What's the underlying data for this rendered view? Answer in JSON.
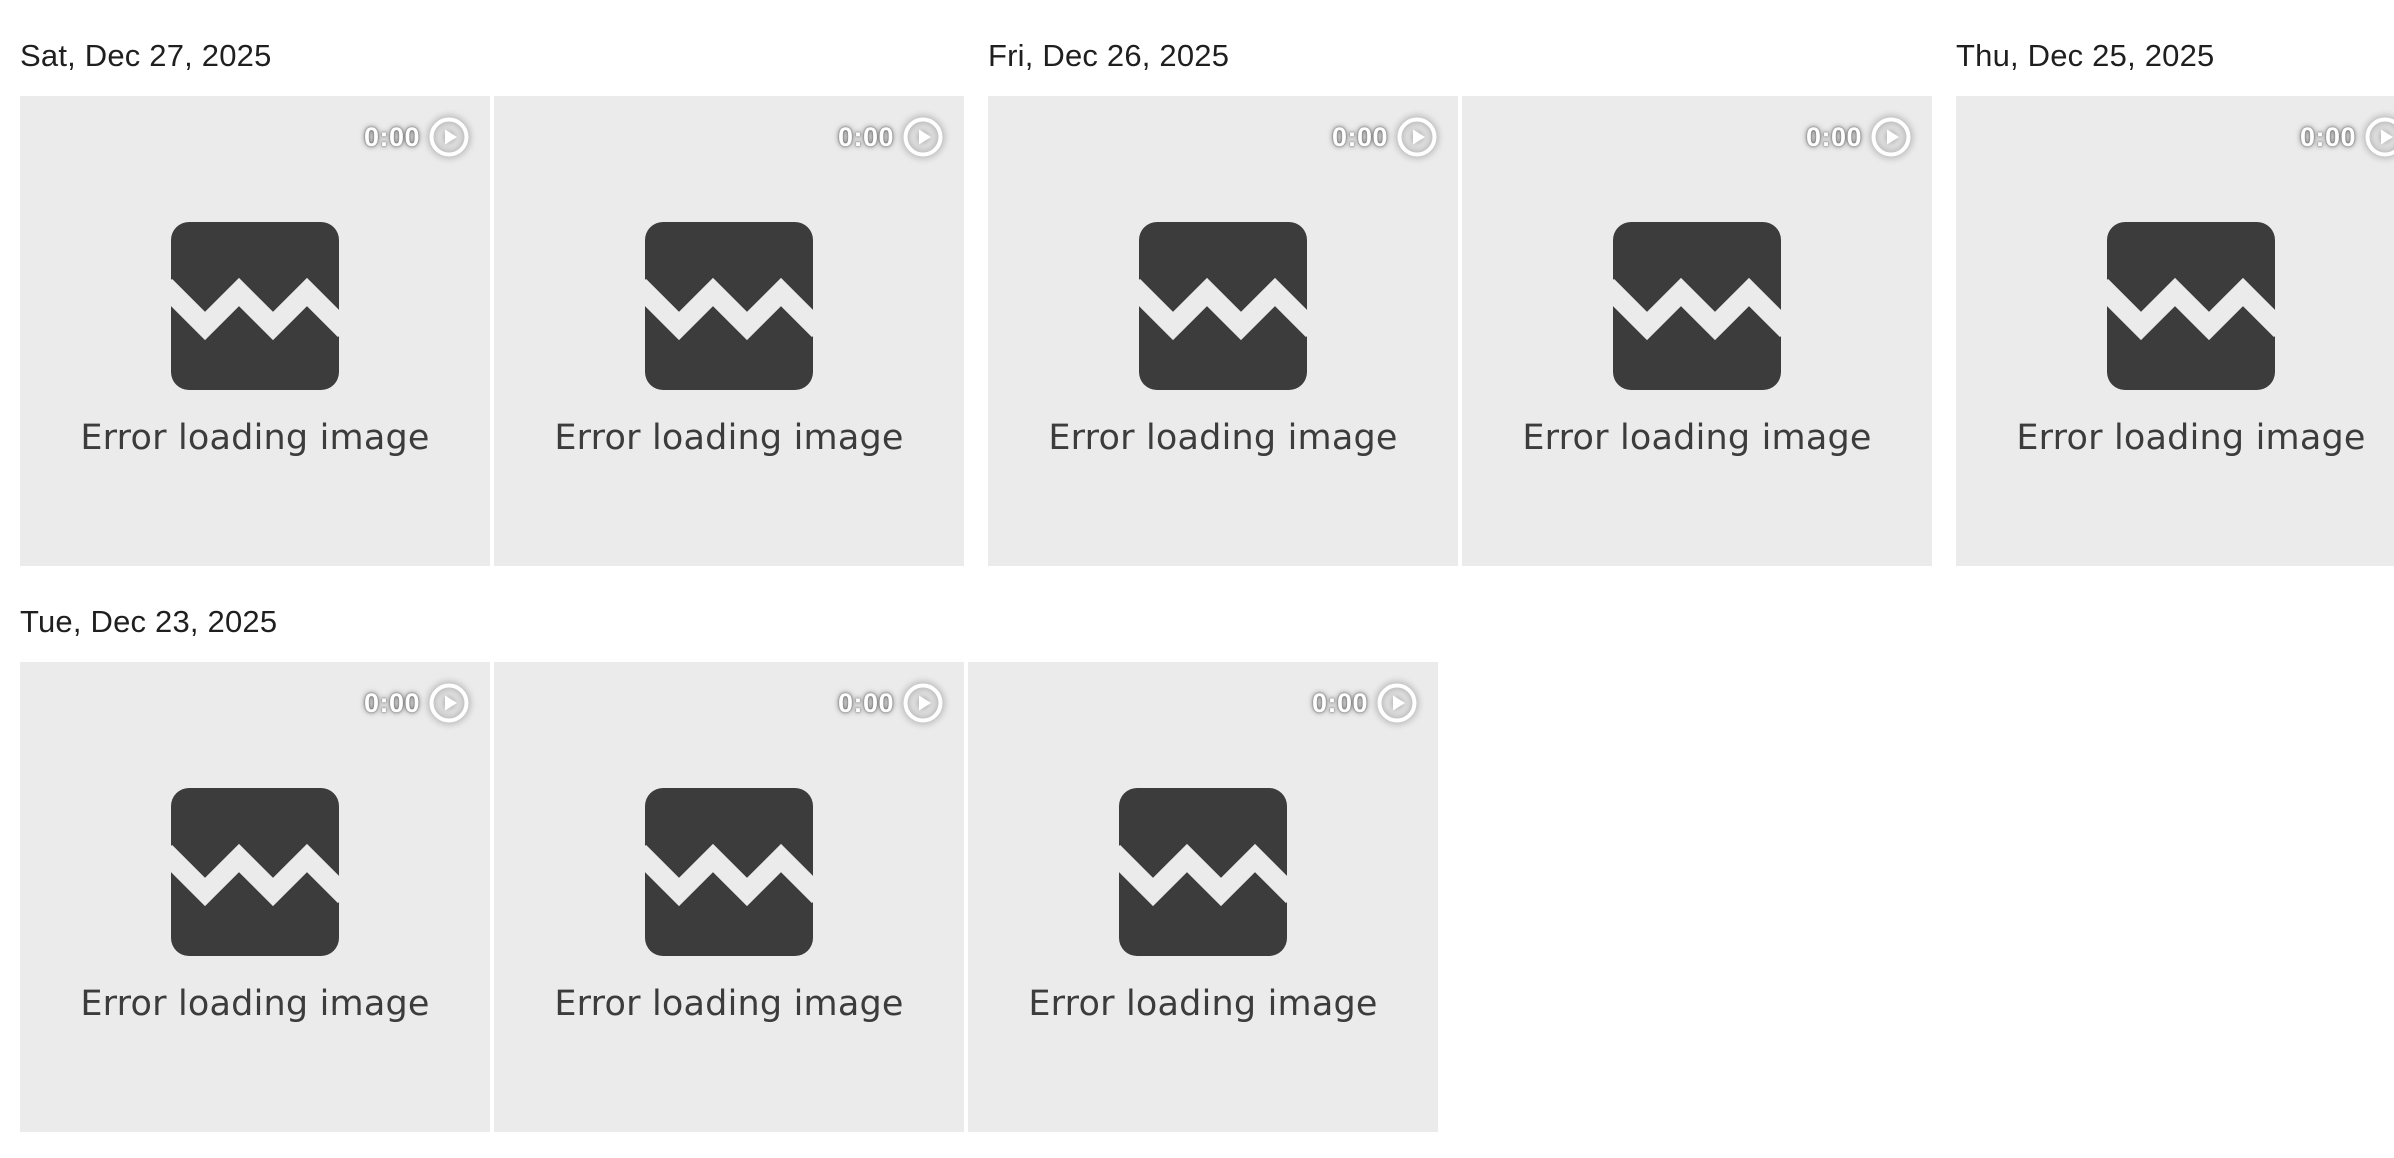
{
  "colors": {
    "tile_background": "#ebebeb",
    "placeholder_icon": "#3c3c3c",
    "heading_text": "#1f1f1f",
    "overlay_text": "#ffffff"
  },
  "groups": [
    {
      "date": "Sat, Dec 27, 2025",
      "items": [
        {
          "duration": "0:00",
          "status": "Error loading image",
          "icon": "broken-image-icon",
          "overlay_icon": "play-circle-icon"
        },
        {
          "duration": "0:00",
          "status": "Error loading image",
          "icon": "broken-image-icon",
          "overlay_icon": "play-circle-icon"
        }
      ]
    },
    {
      "date": "Fri, Dec 26, 2025",
      "items": [
        {
          "duration": "0:00",
          "status": "Error loading image",
          "icon": "broken-image-icon",
          "overlay_icon": "play-circle-icon"
        },
        {
          "duration": "0:00",
          "status": "Error loading image",
          "icon": "broken-image-icon",
          "overlay_icon": "play-circle-icon"
        }
      ]
    },
    {
      "date": "Thu, Dec 25, 2025",
      "items": [
        {
          "duration": "0:00",
          "status": "Error loading image",
          "icon": "broken-image-icon",
          "overlay_icon": "play-circle-icon"
        }
      ]
    },
    {
      "date": "Tue, Dec 23, 2025",
      "items": [
        {
          "duration": "0:00",
          "status": "Error loading image",
          "icon": "broken-image-icon",
          "overlay_icon": "play-circle-icon"
        },
        {
          "duration": "0:00",
          "status": "Error loading image",
          "icon": "broken-image-icon",
          "overlay_icon": "play-circle-icon"
        },
        {
          "duration": "0:00",
          "status": "Error loading image",
          "icon": "broken-image-icon",
          "overlay_icon": "play-circle-icon"
        }
      ]
    }
  ]
}
